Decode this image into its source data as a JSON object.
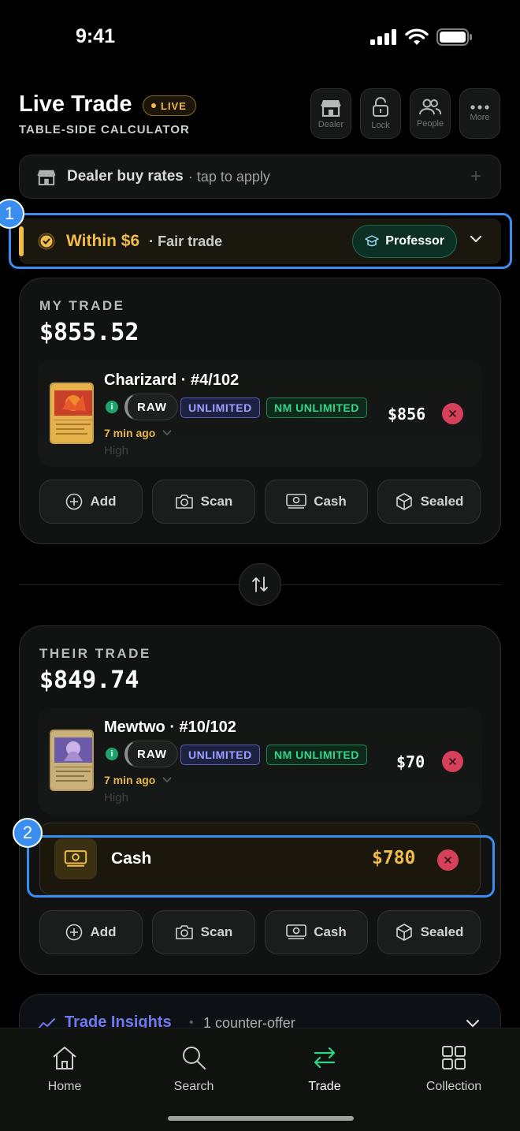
{
  "status_bar": {
    "time": "9:41"
  },
  "header": {
    "title": "Live Trade",
    "live_badge": "LIVE",
    "subtitle": "TABLE-SIDE CALCULATOR",
    "buttons": [
      {
        "label": "Dealer",
        "icon": "store-icon"
      },
      {
        "label": "Lock",
        "icon": "lock-icon"
      },
      {
        "label": "People",
        "icon": "people-icon"
      },
      {
        "label": "More",
        "icon": "more-icon"
      }
    ]
  },
  "dealer_rates": {
    "title": "Dealer buy rates",
    "hint": "· tap to apply",
    "action": "+"
  },
  "fairness": {
    "status": "Within $6",
    "label": "· Fair trade",
    "mode_chip": "Professor",
    "accent_color": "#f0bc4a"
  },
  "step_badges": [
    "1",
    "2"
  ],
  "my_trade": {
    "label": "MY TRADE",
    "total": "$855.52",
    "cards": [
      {
        "name": "Charizard · #4/102",
        "info": "i",
        "condition_type": "RAW",
        "edition": "UNLIMITED",
        "grade": "NM UNLIMITED",
        "added": "7 min ago",
        "price_source": "High",
        "price": "$856",
        "remove": "✕"
      }
    ],
    "actions": [
      "Add",
      "Scan",
      "Cash",
      "Sealed"
    ]
  },
  "their_trade": {
    "label": "THEIR TRADE",
    "total": "$849.74",
    "cards": [
      {
        "name": "Mewtwo · #10/102",
        "info": "i",
        "condition_type": "RAW",
        "edition": "UNLIMITED",
        "grade": "NM UNLIMITED",
        "added": "7 min ago",
        "price_source": "High",
        "price": "$70",
        "remove": "✕"
      }
    ],
    "cash": {
      "label": "Cash",
      "amount": "$780",
      "remove": "✕"
    },
    "actions": [
      "Add",
      "Scan",
      "Cash",
      "Sealed"
    ]
  },
  "insights": {
    "title": "Trade Insights",
    "separator": "•",
    "summary": "1 counter-offer"
  },
  "tab_bar": {
    "tabs": [
      {
        "label": "Home",
        "icon": "home-icon"
      },
      {
        "label": "Search",
        "icon": "search-icon"
      },
      {
        "label": "Trade",
        "icon": "trade-icon",
        "active": true
      },
      {
        "label": "Collection",
        "icon": "grid-icon"
      }
    ],
    "active_color": "#2fd486"
  }
}
